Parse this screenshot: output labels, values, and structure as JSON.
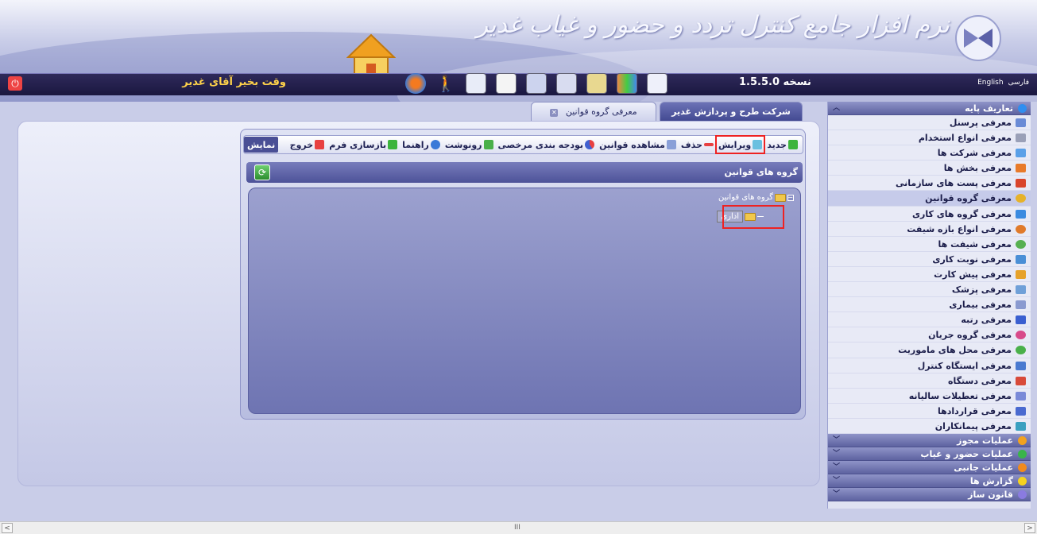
{
  "header": {
    "brand_title": "نرم افزار جامع کنترل تردد و حضور و غیاب غدیر",
    "welcome": "وقت بخیر آقای غدیر",
    "version": "نسخه 1.5.5.0",
    "lang_fa": "فارسی",
    "lang_en": "English"
  },
  "tabs": [
    {
      "label": "شرکت طرح و پردازش غدیر",
      "active": true
    },
    {
      "label": "معرفی گروه قوانین",
      "active": false
    }
  ],
  "toolbar": {
    "new": "جدید",
    "edit": "ویرایش",
    "delete": "حذف",
    "view_rules": "مشاهده قوانین",
    "leave_budget": "بودجه بندی مرخصی",
    "copy": "رونوشت",
    "help": "راهنما",
    "reload_form": "بازسازی فرم",
    "exit": "خروج",
    "show": "نمایش"
  },
  "panel": {
    "title": "گروه های قوانین"
  },
  "tree": {
    "root": "گروه های قوانین",
    "child": "اداری"
  },
  "sidebar": {
    "categories": [
      {
        "label": "تعاریف پایه",
        "color": "#2f8ef0",
        "expanded": true
      },
      {
        "label": "عملیات مجوز",
        "color": "#f2a21e",
        "expanded": false
      },
      {
        "label": "عملیات حضور و غیاب",
        "color": "#39b54a",
        "expanded": false
      },
      {
        "label": "عملیات جانبی",
        "color": "#f08a1e",
        "expanded": false
      },
      {
        "label": "گزارش ها",
        "color": "#f5d21e",
        "expanded": false
      },
      {
        "label": "قانون ساز",
        "color": "#8a7be0",
        "expanded": false
      }
    ],
    "items": [
      {
        "label": "معرفی پرسنل",
        "color": "#6a8bd6"
      },
      {
        "label": "معرفی انواع استخدام",
        "color": "#9aa0b8"
      },
      {
        "label": "معرفی شرکت ها",
        "color": "#5aa0e8"
      },
      {
        "label": "معرفی بخش ها",
        "color": "#e87a2a"
      },
      {
        "label": "معرفی پست های سازمانی",
        "color": "#d9452b"
      },
      {
        "label": "معرفی گروه قوانین",
        "color": "#e6b22a"
      },
      {
        "label": "معرفی گروه های کاری",
        "color": "#3b8be0"
      },
      {
        "label": "معرفی انواع بازه شیفت",
        "color": "#e07a2a"
      },
      {
        "label": "معرفی شیفت ها",
        "color": "#57b050"
      },
      {
        "label": "معرفی نوبت کاری",
        "color": "#4a8fd6"
      },
      {
        "label": "معرفی پیش کارت",
        "color": "#e6a22a"
      },
      {
        "label": "معرفی پزشک",
        "color": "#6fa0d8"
      },
      {
        "label": "معرفی بیماری",
        "color": "#8a9ad0"
      },
      {
        "label": "معرفی رتبه",
        "color": "#3a5fd0"
      },
      {
        "label": "معرفی گروه جریان",
        "color": "#d84a8a"
      },
      {
        "label": "معرفی محل های ماموریت",
        "color": "#4ab04a"
      },
      {
        "label": "معرفی ایستگاه کنترل",
        "color": "#4a7ad0"
      },
      {
        "label": "معرفی دستگاه",
        "color": "#d84a3a"
      },
      {
        "label": "معرفی تعطیلات سالیانه",
        "color": "#7a8ad8"
      },
      {
        "label": "معرفی قراردادها",
        "color": "#4a6ad0"
      },
      {
        "label": "معرفی پیمانکاران",
        "color": "#3aa0c0"
      }
    ],
    "active_item": "معرفی گروه قوانین"
  },
  "scrollbar": {
    "grip": "III"
  }
}
